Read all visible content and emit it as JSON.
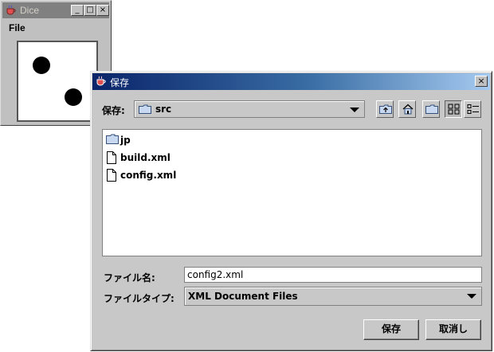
{
  "dice_window": {
    "title": "Dice",
    "minimize": "_",
    "maximize": "□",
    "close": "×",
    "menu": {
      "file_label": "File"
    },
    "die_value": 2
  },
  "save_dialog": {
    "title": "保存",
    "close": "×",
    "look_in": {
      "label": "保存:",
      "value": "src"
    },
    "toolbar": [
      "up-one-level",
      "home",
      "new-folder",
      "list-view",
      "details-view"
    ],
    "files": [
      {
        "name": "jp",
        "type": "folder"
      },
      {
        "name": "build.xml",
        "type": "file"
      },
      {
        "name": "config.xml",
        "type": "file"
      }
    ],
    "file_name": {
      "label": "ファイル名:",
      "value": "config2.xml"
    },
    "file_type": {
      "label": "ファイルタイプ:",
      "value": "XML Document Files"
    },
    "buttons": {
      "save": "保存",
      "cancel": "取消し"
    }
  },
  "colors": {
    "title_active_start": "#0a246a",
    "title_active_end": "#a6caf0",
    "title_inactive": "#808080",
    "window_bg": "#c8c8c8"
  }
}
